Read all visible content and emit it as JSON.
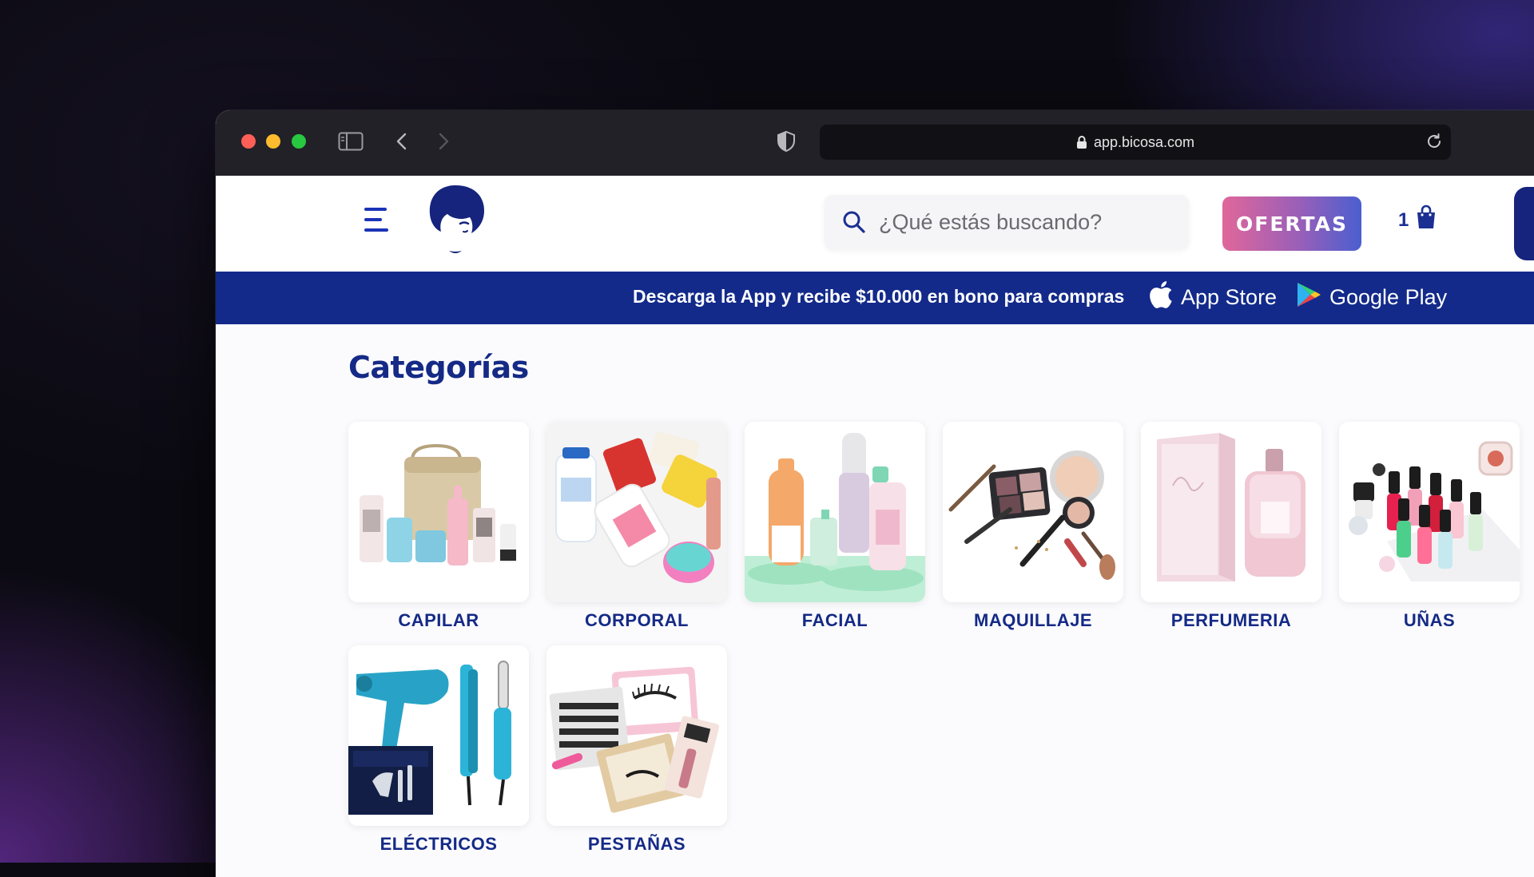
{
  "browser": {
    "url": "app.bicosa.com"
  },
  "header": {
    "search_placeholder": "¿Qué estás buscando?",
    "ofertas_label": "OFERTAS",
    "cart_count": "1"
  },
  "banner": {
    "promo_text": "Descarga la App y recibe $10.000 en bono para compras",
    "app_store_label": "App Store",
    "google_play_label": "Google Play"
  },
  "categories": {
    "title": "Categorías",
    "items": [
      {
        "label": "CAPILAR"
      },
      {
        "label": "CORPORAL"
      },
      {
        "label": "FACIAL"
      },
      {
        "label": "MAQUILLAJE"
      },
      {
        "label": "PERFUMERIA"
      },
      {
        "label": "UÑAS"
      },
      {
        "label": "ELÉCTRICOS"
      },
      {
        "label": "PESTAÑAS"
      }
    ]
  },
  "colors": {
    "brand_blue": "#132a8a",
    "heading_blue": "#152a86",
    "ofertas_gradient_start": "#e0679a",
    "ofertas_gradient_end": "#4a5fd0"
  }
}
